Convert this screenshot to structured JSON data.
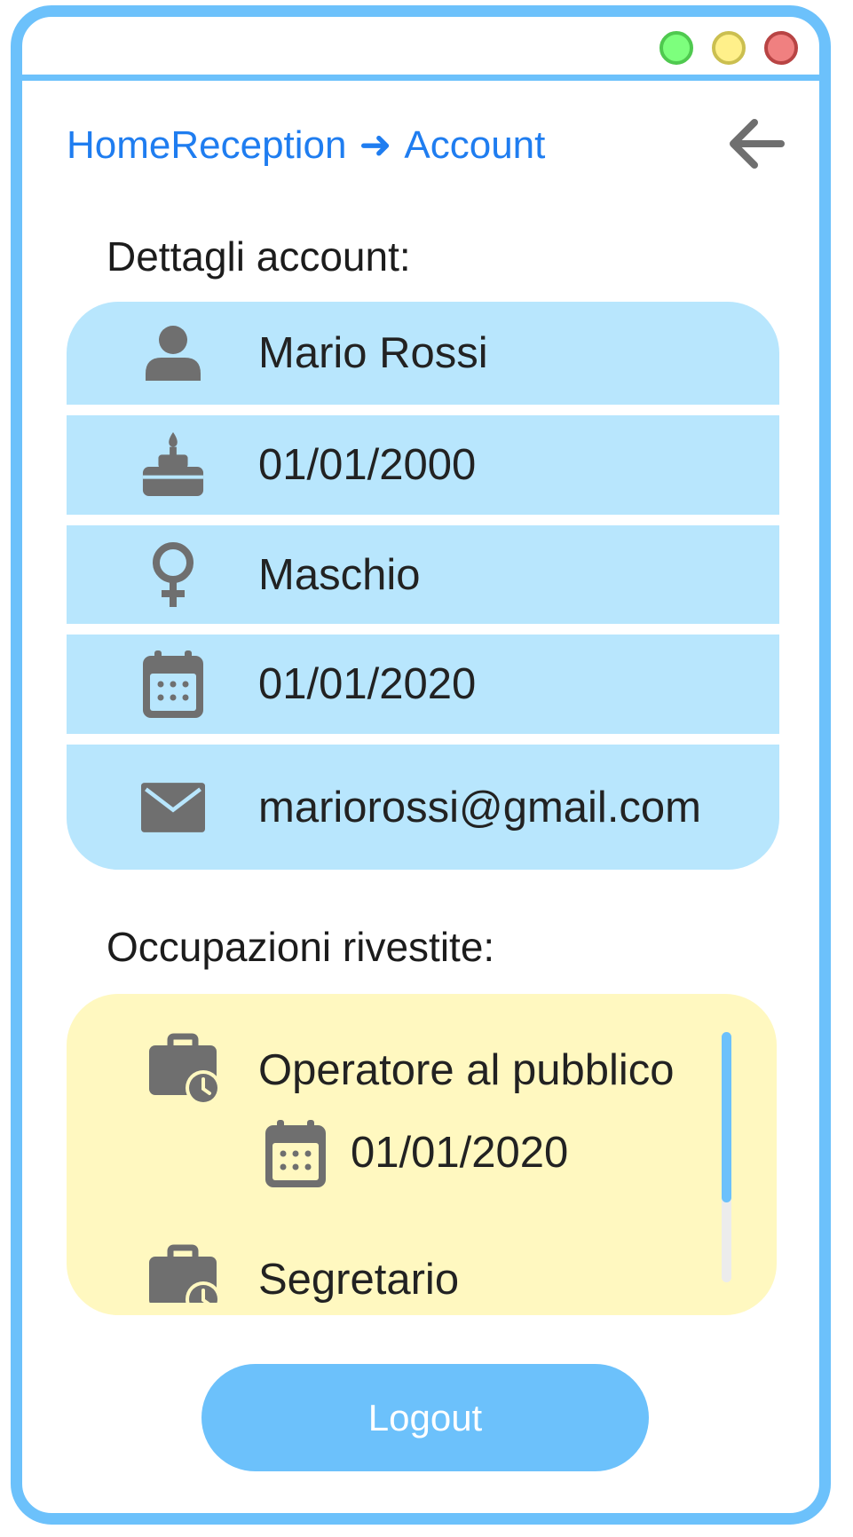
{
  "window": {
    "controls": [
      {
        "name": "minimize-dot",
        "color": "#7dff7d"
      },
      {
        "name": "maximize-dot",
        "color": "#fff08a"
      },
      {
        "name": "close-dot",
        "color": "#f08080"
      }
    ]
  },
  "breadcrumb": {
    "items": [
      "HomeReception",
      "Account"
    ],
    "separator": "➜"
  },
  "back_icon": "arrow-left-icon",
  "account": {
    "section_title": "Dettagli account:",
    "rows": [
      {
        "icon": "user-icon",
        "value": "Mario Rossi"
      },
      {
        "icon": "birthday-cake-icon",
        "value": "01/01/2000"
      },
      {
        "icon": "gender-icon",
        "value": "Maschio"
      },
      {
        "icon": "calendar-icon",
        "value": "01/01/2020"
      },
      {
        "icon": "envelope-icon",
        "value": "mariorossi@gmail.com"
      }
    ]
  },
  "occupations": {
    "section_title": "Occupazioni rivestite:",
    "items": [
      {
        "icon": "briefcase-clock-icon",
        "title": "Operatore al pubblico",
        "date_icon": "calendar-icon",
        "date": "01/01/2020"
      },
      {
        "icon": "briefcase-clock-icon",
        "title": "Segretario"
      }
    ]
  },
  "logout_label": "Logout",
  "colors": {
    "accent": "#6cc1fb",
    "link": "#1f7df0",
    "account_card": "#b8e6fd",
    "occupation_card": "#fff8c0",
    "icon": "#6f6f6f"
  }
}
